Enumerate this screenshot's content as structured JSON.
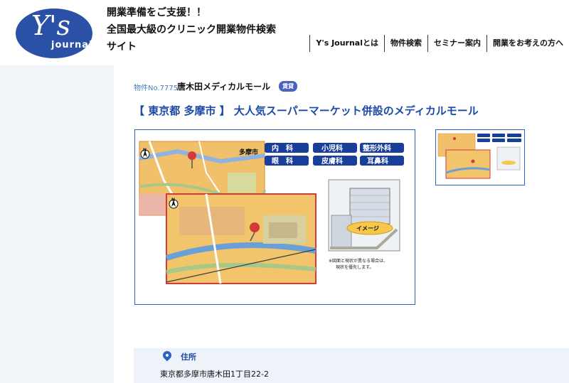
{
  "logo": {
    "main": "Y's",
    "sub": "journal"
  },
  "tagline": {
    "line1": "開業準備をご支援！！",
    "line2": "全国最大級のクリニック開業物件検索",
    "line3": "サイト"
  },
  "nav": [
    {
      "label": "Y's Journalとは"
    },
    {
      "label": "物件検索"
    },
    {
      "label": "セミナー案内"
    },
    {
      "label": "開業をお考えの方へ"
    }
  ],
  "property": {
    "number": "物件No.7775",
    "name": "唐木田メディカルモール",
    "badge": "賃貸",
    "headline": "【 東京都 多摩市 】 大人気スーパーマーケット併設のメディカルモール"
  },
  "image": {
    "departments": [
      "内　科",
      "小児科",
      "整形外科",
      "眼　科",
      "皮膚科",
      "耳鼻科"
    ],
    "city_label": "多摩市",
    "image_label": "イメージ",
    "note_line1": "※図面と現状が異なる場合は、",
    "note_line2": "現状を優先します。",
    "north": "N",
    "colors": {
      "map_orange": "#f2c46b",
      "map_blue": "#6aa0d8",
      "map_red": "#d53a3a",
      "tag_blue": "#1a3f9a"
    }
  },
  "address": {
    "label": "住所",
    "value": "東京都多摩市唐木田1丁目22-2"
  }
}
